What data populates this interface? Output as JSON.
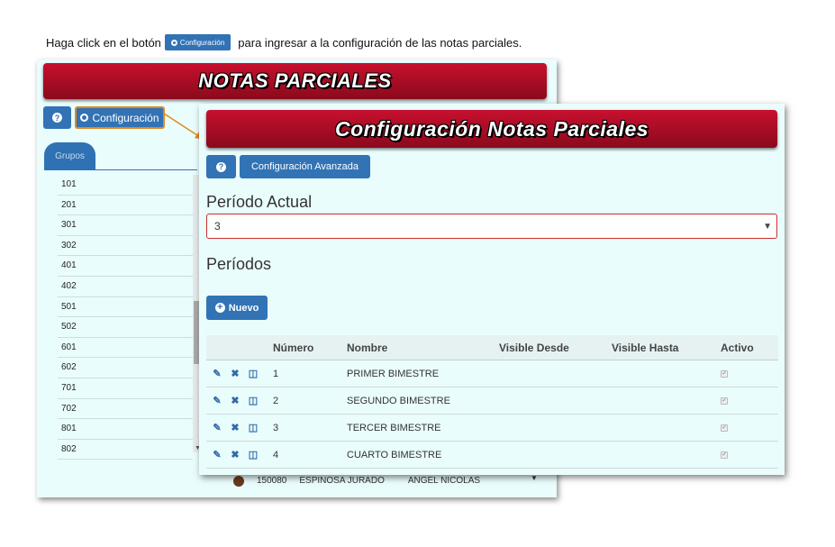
{
  "instruction": {
    "before": "Haga click en el botón",
    "button_label": "Configuración",
    "after": "para ingresar a la configuración de las notas parciales."
  },
  "background_window": {
    "title": "NOTAS PARCIALES",
    "help_icon": "question-icon",
    "config_label": "Configuración",
    "tab_label": "Grupos",
    "groups": [
      "101",
      "201",
      "301",
      "302",
      "401",
      "402",
      "501",
      "502",
      "601",
      "602",
      "701",
      "702",
      "801",
      "802"
    ],
    "partial_row": {
      "code": "150080",
      "surname": "ESPINOSA JURADO",
      "name": "ANGEL NICOLAS"
    }
  },
  "config_window": {
    "title": "Configuración Notas Parciales",
    "advanced_label": "Configuración Avanzada",
    "current_period_label": "Período Actual",
    "current_period_value": "3",
    "periods_label": "Períodos",
    "new_label": "Nuevo",
    "table": {
      "headers": [
        "Número",
        "Nombre",
        "Visible Desde",
        "Visible Hasta",
        "Activo"
      ],
      "rows": [
        {
          "numero": "1",
          "nombre": "PRIMER BIMESTRE",
          "desde": "",
          "hasta": "",
          "activo": true
        },
        {
          "numero": "2",
          "nombre": "SEGUNDO BIMESTRE",
          "desde": "",
          "hasta": "",
          "activo": true
        },
        {
          "numero": "3",
          "nombre": "TERCER BIMESTRE",
          "desde": "",
          "hasta": "",
          "activo": true
        },
        {
          "numero": "4",
          "nombre": "CUARTO BIMESTRE",
          "desde": "",
          "hasta": "",
          "activo": true
        }
      ]
    }
  },
  "colors": {
    "header_red": "#c8102e",
    "button_blue": "#3173b5",
    "panel_bg": "#eafdfd",
    "highlight_orange": "#e08a1c"
  }
}
